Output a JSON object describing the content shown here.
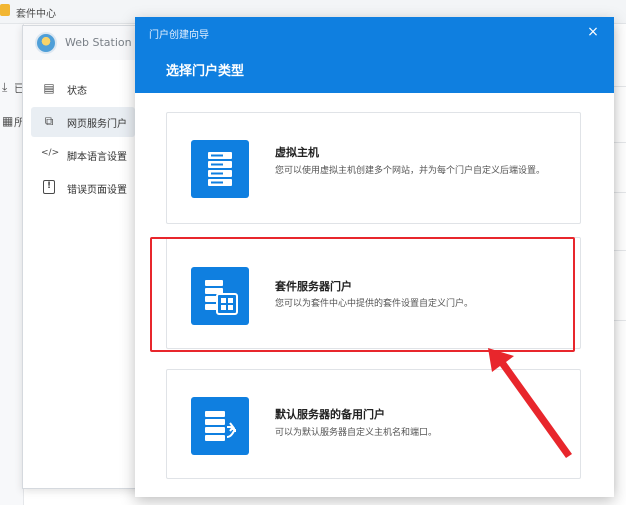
{
  "package_center": {
    "title": "套件中心",
    "strip_items": [
      {
        "icon": "download-icon",
        "glyph": "⤓",
        "label": "已"
      },
      {
        "icon": "grid-icon",
        "glyph": "▦",
        "label": "所"
      }
    ]
  },
  "web_station": {
    "title": "Web Station",
    "nav": [
      {
        "icon": "status-icon",
        "glyph": "▤",
        "label": "状态"
      },
      {
        "icon": "web-portal-icon",
        "glyph": "⧉",
        "label": "网页服务门户",
        "active": true
      },
      {
        "icon": "script-icon",
        "glyph": "</>",
        "label": "脚本语言设置"
      },
      {
        "icon": "error-page-icon",
        "glyph": "!",
        "label": "错误页面设置"
      }
    ]
  },
  "wizard": {
    "title": "门户创建向导",
    "close_glyph": "×",
    "subtitle": "选择门户类型",
    "options": [
      {
        "icon": "virtual-host-icon",
        "title": "虚拟主机",
        "description": "您可以使用虚拟主机创建多个网站，并为每个门户自定义后端设置。"
      },
      {
        "icon": "package-server-icon",
        "title": "套件服务器门户",
        "description": "您可以为套件中心中提供的套件设置自定义门户。"
      },
      {
        "icon": "default-server-icon",
        "title": "默认服务器的备用门户",
        "description": "可以为默认服务器自定义主机名和端口。"
      }
    ]
  },
  "annotation": {
    "highlight_color": "#e8262c"
  }
}
